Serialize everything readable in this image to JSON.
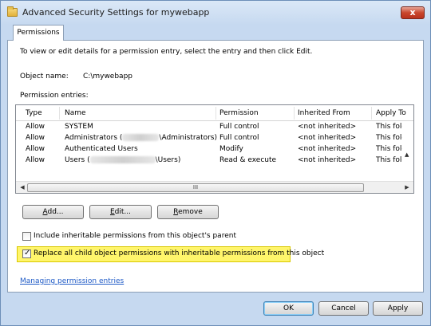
{
  "window": {
    "title": "Advanced Security Settings for mywebapp",
    "close_label": "x"
  },
  "tabs": [
    {
      "label": "Permissions"
    }
  ],
  "intro_text": "To view or edit details for a permission entry, select the entry and then click Edit.",
  "object": {
    "label": "Object name:",
    "value": "C:\\mywebapp"
  },
  "entries_label": "Permission entries:",
  "table": {
    "columns": [
      "Type",
      "Name",
      "Permission",
      "Inherited From",
      "Apply To"
    ],
    "rows": [
      {
        "type": "Allow",
        "name": "SYSTEM",
        "name_suffix": "",
        "permission": "Full control",
        "inherited": "<not inherited>",
        "apply": "This folder,"
      },
      {
        "type": "Allow",
        "name": "Administrators (",
        "name_suffix": "\\Administrators)",
        "permission": "Full control",
        "inherited": "<not inherited>",
        "apply": "This folder,"
      },
      {
        "type": "Allow",
        "name": "Authenticated Users",
        "name_suffix": "",
        "permission": "Modify",
        "inherited": "<not inherited>",
        "apply": "This folder,"
      },
      {
        "type": "Allow",
        "name": "Users (",
        "name_suffix": "\\Users)",
        "permission": "Read & execute",
        "inherited": "<not inherited>",
        "apply": "This folder,"
      }
    ],
    "scroll_thumb_glyph": "III"
  },
  "buttons": {
    "add": {
      "ul": "A",
      "rest": "dd..."
    },
    "edit": {
      "ul": "E",
      "rest": "dit..."
    },
    "remove": {
      "ul": "R",
      "rest": "emove"
    }
  },
  "checkboxes": {
    "include": {
      "label": "Include inheritable permissions from this object's parent",
      "checked": false
    },
    "replace": {
      "label": "Replace all child object permissions with inheritable permissions from this object",
      "checked": true
    }
  },
  "link": "Managing permission entries",
  "dialog_buttons": {
    "ok": "OK",
    "cancel": "Cancel",
    "apply": "Apply"
  },
  "colors": {
    "highlight": "#fff56b",
    "link": "#1d59c6",
    "close": "#c9462c"
  }
}
